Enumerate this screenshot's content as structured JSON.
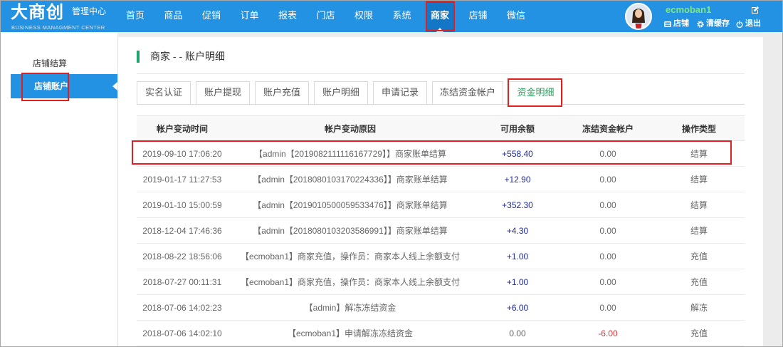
{
  "header": {
    "logo_main": "大商创",
    "logo_sub": "管理中心",
    "logo_en": "BUSINESS MANAGMENT CENTER",
    "nav": [
      {
        "label": "首页"
      },
      {
        "label": "商品"
      },
      {
        "label": "促销"
      },
      {
        "label": "订单"
      },
      {
        "label": "报表"
      },
      {
        "label": "门店"
      },
      {
        "label": "权限"
      },
      {
        "label": "系统"
      },
      {
        "label": "商家",
        "active": true
      },
      {
        "label": "店铺"
      },
      {
        "label": "微信"
      }
    ],
    "user": {
      "name": "ecmoban1",
      "avatar_icon": "avatar-photo",
      "edit_icon": "edit-icon",
      "links": [
        {
          "label": "店铺",
          "icon": "store-icon"
        },
        {
          "label": "清缓存",
          "icon": "gear-icon"
        },
        {
          "label": "退出",
          "icon": "power-icon"
        }
      ]
    }
  },
  "sidebar": {
    "items": [
      {
        "label": "店铺结算"
      },
      {
        "label": "店铺账户",
        "active": true
      }
    ]
  },
  "main": {
    "title": "商家 - - 账户明细",
    "tabs": [
      {
        "label": "实名认证"
      },
      {
        "label": "账户提现"
      },
      {
        "label": "账户充值"
      },
      {
        "label": "账户明细"
      },
      {
        "label": "申请记录"
      },
      {
        "label": "冻结资金帐户"
      },
      {
        "label": "资金明细",
        "active": true
      }
    ],
    "table": {
      "columns": [
        "帐户变动时间",
        "帐户变动原因",
        "可用余额",
        "冻结资金帐户",
        "操作类型"
      ],
      "rows": [
        {
          "time": "2019-09-10 17:06:20",
          "reason": "【admin【2019082111116167729】】商家账单结算",
          "available": "+558.40",
          "frozen": "0.00",
          "type": "结算"
        },
        {
          "time": "2019-01-17 11:27:53",
          "reason": "【admin【2018080103170224336】】商家账单结算",
          "available": "+12.90",
          "frozen": "0.00",
          "type": "结算"
        },
        {
          "time": "2019-01-10 15:00:59",
          "reason": "【admin【2019010500059533476】】商家账单结算",
          "available": "+352.30",
          "frozen": "0.00",
          "type": "结算"
        },
        {
          "time": "2018-12-04 17:46:36",
          "reason": "【admin【2018080103203586991】】商家账单结算",
          "available": "+4.30",
          "frozen": "0.00",
          "type": "结算"
        },
        {
          "time": "2018-08-22 18:56:06",
          "reason": "【ecmoban1】商家充值，操作员：商家本人线上余额支付",
          "available": "+1.00",
          "frozen": "0.00",
          "type": "充值"
        },
        {
          "time": "2018-07-27 00:11:31",
          "reason": "【ecmoban1】商家充值，操作员：商家本人线上余额支付",
          "available": "+1.00",
          "frozen": "0.00",
          "type": "充值"
        },
        {
          "time": "2018-07-06 14:02:23",
          "reason": "【admin】解冻冻结资金",
          "available": "+6.00",
          "frozen": "0.00",
          "type": "解冻"
        },
        {
          "time": "2018-07-06 14:02:10",
          "reason": "【ecmoban1】申请解冻冻结资金",
          "available": "0.00",
          "frozen": "-6.00",
          "type": "充值"
        }
      ]
    }
  },
  "colors": {
    "topbar": "#2392e3",
    "topbar_active": "#1476c6",
    "username": "#7ee87e",
    "title_accent": "#1ea36a",
    "active_tab_text": "#27a35b",
    "positive_amount": "#1f2aa0",
    "negative_amount": "#e03333",
    "highlight_box": "#e0201f"
  }
}
